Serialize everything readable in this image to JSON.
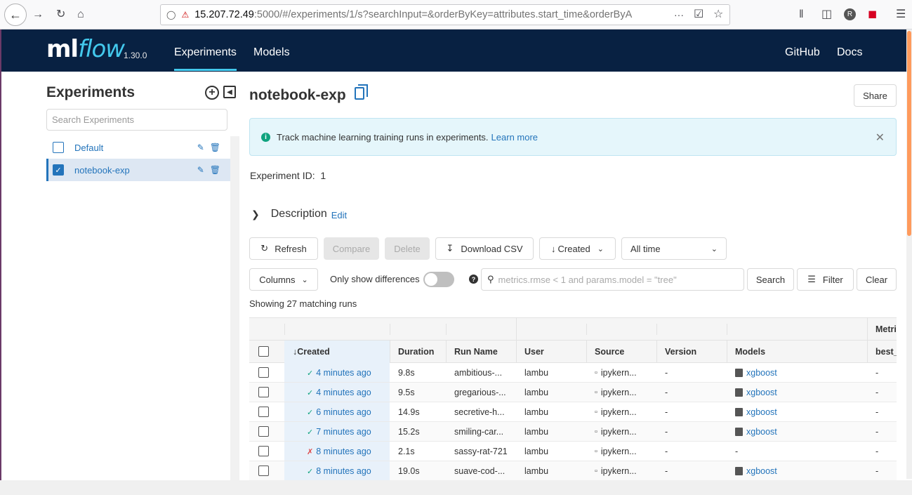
{
  "browser": {
    "url_host": "15.207.72.49",
    "url_rest": ":5000/#/experiments/1/s?searchInput=&orderByKey=attributes.start_time&orderByA",
    "more": "···",
    "profile_initial": "R"
  },
  "header": {
    "logo_ml": "ml",
    "logo_flow": "flow",
    "version": "1.30.0",
    "nav": [
      "Experiments",
      "Models"
    ],
    "right_links": [
      "GitHub",
      "Docs"
    ]
  },
  "sidebar": {
    "title": "Experiments",
    "search_placeholder": "Search Experiments",
    "items": [
      {
        "name": "Default",
        "selected": false
      },
      {
        "name": "notebook-exp",
        "selected": true
      }
    ]
  },
  "main": {
    "title": "notebook-exp",
    "share_label": "Share",
    "info_text": "Track machine learning training runs in experiments.",
    "info_link": "Learn more",
    "experiment_id_label": "Experiment ID",
    "experiment_id_value": "1",
    "description_label": "Description",
    "description_edit": "Edit",
    "toolbar": {
      "refresh": "Refresh",
      "compare": "Compare",
      "delete": "Delete",
      "download": "Download CSV",
      "sort": "Created",
      "time": "All time",
      "columns": "Columns",
      "only_diff": "Only show differences",
      "search_placeholder": "metrics.rmse < 1 and params.model = \"tree\"",
      "search": "Search",
      "filter": "Filter",
      "clear": "Clear"
    },
    "showing": "Showing 27 matching runs"
  },
  "table": {
    "group_header": "Metri",
    "columns": [
      "Created",
      "Duration",
      "Run Name",
      "User",
      "Source",
      "Version",
      "Models",
      "best_"
    ],
    "rows": [
      {
        "status": "ok",
        "created": "4 minutes ago",
        "duration": "9.8s",
        "run_name": "ambitious-...",
        "user": "lambu",
        "source": "ipykern...",
        "version": "-",
        "models": "xgboost",
        "metric": "-"
      },
      {
        "status": "ok",
        "created": "4 minutes ago",
        "duration": "9.5s",
        "run_name": "gregarious-...",
        "user": "lambu",
        "source": "ipykern...",
        "version": "-",
        "models": "xgboost",
        "metric": "-"
      },
      {
        "status": "ok",
        "created": "6 minutes ago",
        "duration": "14.9s",
        "run_name": "secretive-h...",
        "user": "lambu",
        "source": "ipykern...",
        "version": "-",
        "models": "xgboost",
        "metric": "-"
      },
      {
        "status": "ok",
        "created": "7 minutes ago",
        "duration": "15.2s",
        "run_name": "smiling-car...",
        "user": "lambu",
        "source": "ipykern...",
        "version": "-",
        "models": "xgboost",
        "metric": "-"
      },
      {
        "status": "fail",
        "created": "8 minutes ago",
        "duration": "2.1s",
        "run_name": "sassy-rat-721",
        "user": "lambu",
        "source": "ipykern...",
        "version": "-",
        "models": "-",
        "metric": "-"
      },
      {
        "status": "ok",
        "created": "8 minutes ago",
        "duration": "19.0s",
        "run_name": "suave-cod-...",
        "user": "lambu",
        "source": "ipykern...",
        "version": "-",
        "models": "xgboost",
        "metric": "-"
      }
    ]
  },
  "colors": {
    "header_bg": "#082142",
    "accent": "#43C9ED",
    "link": "#2374bb",
    "success": "#0fa37f",
    "fail": "#dd4444"
  }
}
